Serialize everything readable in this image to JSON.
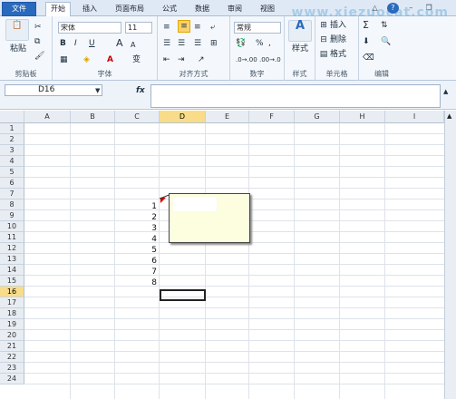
{
  "tabs": [
    "文件",
    "开始",
    "插入",
    "页面布局",
    "公式",
    "数据",
    "审阅",
    "视图"
  ],
  "watermark": "www.xiezuocat.com",
  "ribbon": {
    "clipboard": {
      "paste": "粘贴",
      "label": "剪贴板"
    },
    "font": {
      "name": "宋体",
      "size": "11",
      "bold": "B",
      "italic": "I",
      "underline": "U",
      "grow": "A",
      "shrink": "A",
      "wen": "变",
      "label": "字体"
    },
    "alignment": {
      "label": "对齐方式"
    },
    "number": {
      "format": "常规",
      "percent": "%",
      "comma": ",",
      "label": "数字"
    },
    "styles": {
      "label": "样式"
    },
    "cells": {
      "insert": "插入",
      "delete": "删除",
      "format": "格式",
      "label": "单元格"
    },
    "editing": {
      "label": "编辑"
    }
  },
  "formula_bar": {
    "name_box": "D16",
    "fx": "fx",
    "value": ""
  },
  "columns": [
    "A",
    "B",
    "C",
    "D",
    "E",
    "F",
    "G",
    "H",
    "I"
  ],
  "rows": [
    "1",
    "2",
    "3",
    "4",
    "5",
    "6",
    "7",
    "8",
    "9",
    "10",
    "11",
    "12",
    "13",
    "14",
    "15",
    "16",
    "17",
    "18",
    "19",
    "20",
    "21",
    "22",
    "23",
    "24"
  ],
  "active_cell": {
    "column": "D",
    "row": "16"
  },
  "cell_values": [
    "1",
    "2",
    "3",
    "4",
    "5",
    "6",
    "7",
    "8"
  ]
}
